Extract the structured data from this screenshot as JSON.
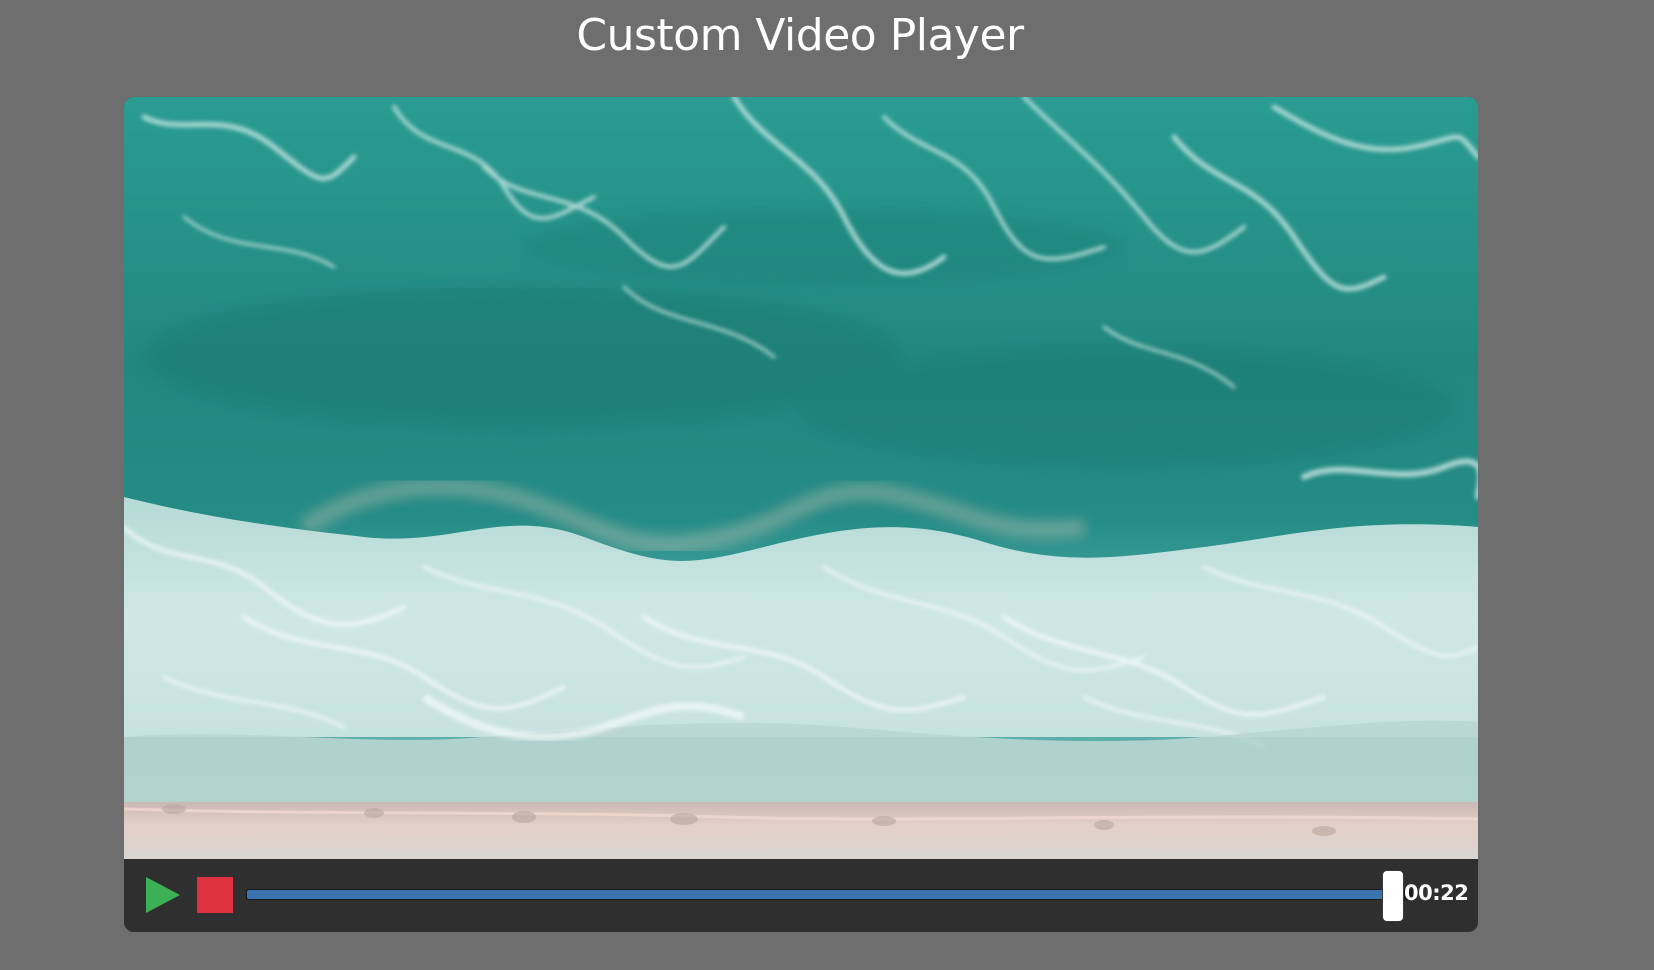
{
  "page": {
    "title": "Custom Video Player"
  },
  "player": {
    "video": {
      "scene": "aerial-ocean-waves-beach"
    },
    "controls": {
      "play_icon": "play-icon",
      "stop_icon": "stop-icon",
      "progress_fraction": 0.99,
      "time": "00:22"
    }
  },
  "colors": {
    "page_background": "#6e6e6e",
    "controls_background": "#2f2f2f",
    "play": "#3cb054",
    "stop": "#e03342",
    "progress": "#3a73ad",
    "thumb": "#ffffff"
  }
}
